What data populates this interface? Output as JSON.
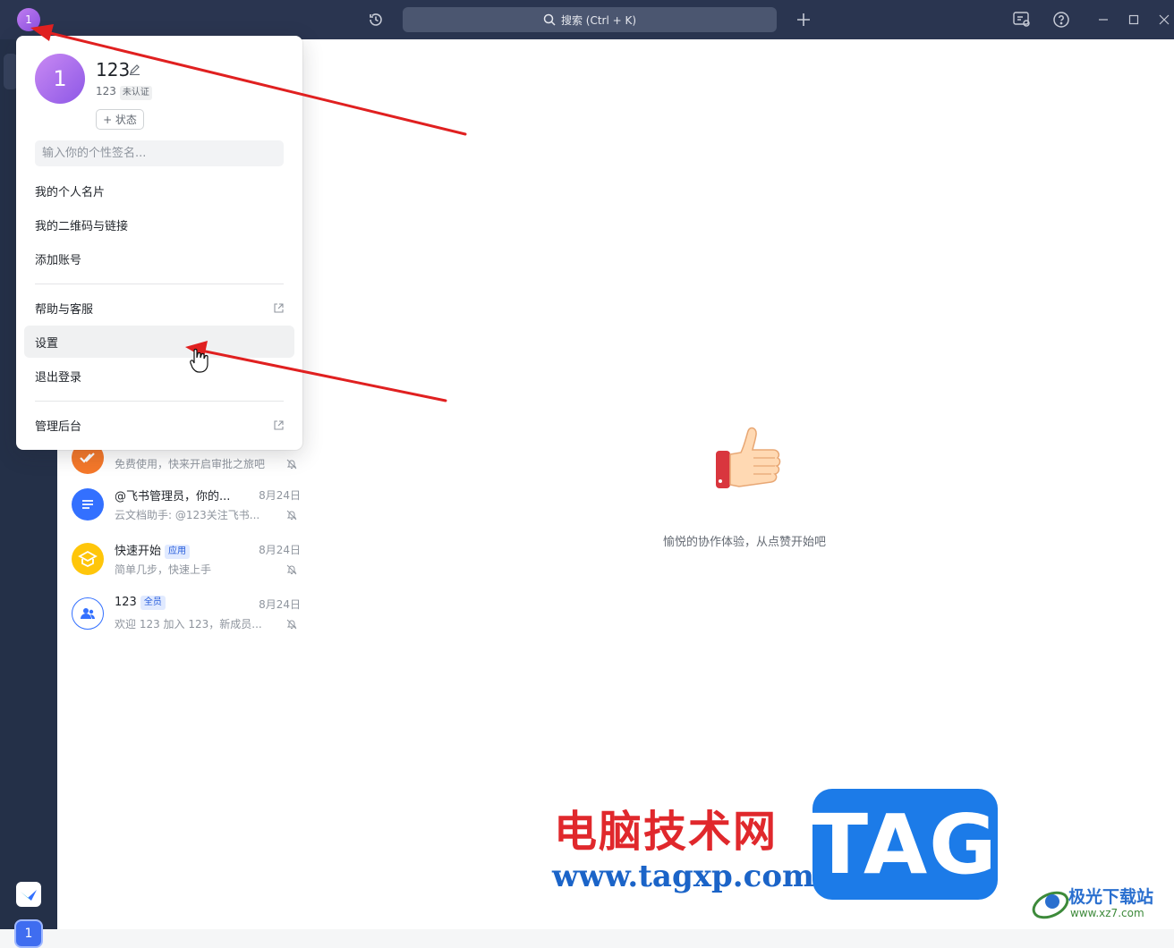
{
  "titlebar": {
    "avatar_initial": "1",
    "search_label": "搜索 (Ctrl + K)"
  },
  "sidebar": {
    "account_initial": "1"
  },
  "profile_popup": {
    "avatar_initial": "1",
    "name": "123",
    "tenant": "123",
    "verify_badge": "未认证",
    "status_button": "+ 状态",
    "signature_placeholder": "输入你的个性签名...",
    "items": [
      {
        "label": "我的个人名片"
      },
      {
        "label": "我的二维码与链接"
      },
      {
        "label": "添加账号"
      },
      {
        "label": "帮助与客服"
      },
      {
        "label": "设置"
      },
      {
        "label": "退出登录"
      },
      {
        "label": "管理后台"
      }
    ]
  },
  "chats": [
    {
      "title": "",
      "tag": "",
      "subtitle": "免费使用，快来开启审批之旅吧",
      "date": "",
      "avatar_color": "#f5782a"
    },
    {
      "title": "@飞书管理员，你的...",
      "tag": "",
      "subtitle": "云文档助手: @123关注飞书...",
      "date": "8月24日",
      "avatar_color": "#3370ff"
    },
    {
      "title": "快速开始",
      "tag": "应用",
      "subtitle": "简单几步，快速上手",
      "date": "8月24日",
      "avatar_color": "#ffc60a"
    },
    {
      "title": "123",
      "tag": "全员",
      "subtitle": "欢迎 123 加入 123，新成员...",
      "date": "8月24日",
      "avatar_color": "#ffffff"
    }
  ],
  "main": {
    "empty_text": "愉悦的协作体验，从点赞开始吧"
  },
  "watermark": {
    "site_cn": "电脑技术网",
    "site_url": "www.tagxp.com",
    "tag": "TAG",
    "site2_cn": "极光下载站",
    "site2_url": "www.xz7.com"
  },
  "colors": {
    "titlebar": "#2a3550",
    "sidebar": "#243048",
    "accent": "#3370ff",
    "arrow": "#e02020"
  }
}
